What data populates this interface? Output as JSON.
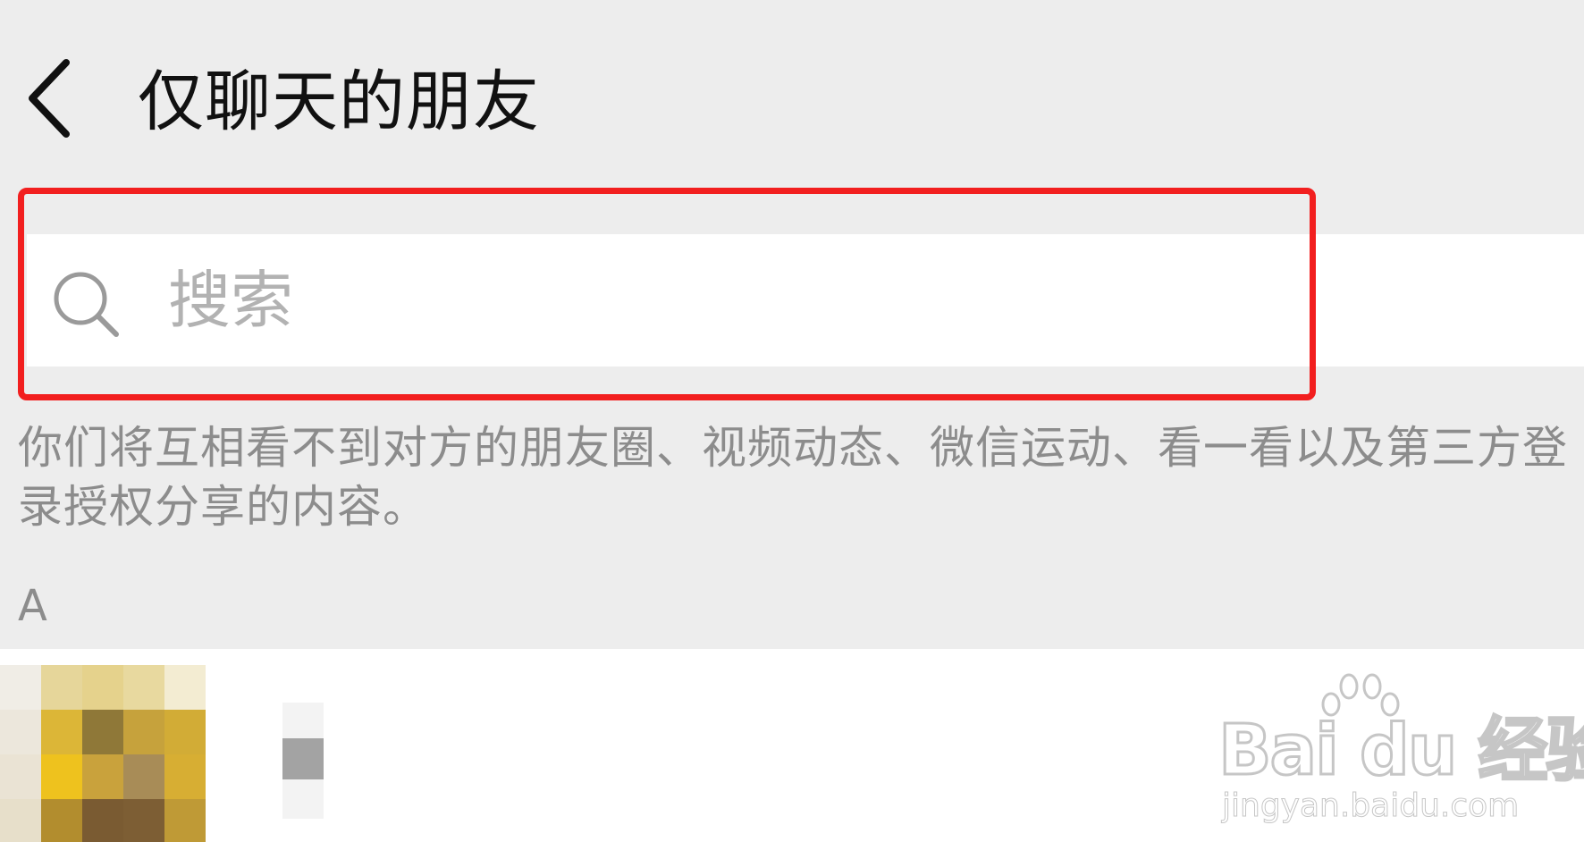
{
  "header": {
    "title": "仅聊天的朋友",
    "back_icon": "chevron-left-icon"
  },
  "search": {
    "placeholder": "搜索",
    "value": "",
    "icon": "search-icon"
  },
  "notice": {
    "text": "你们将互相看不到对方的朋友圈、视频动态、微信运动、看一看以及第三方登录授权分享的内容。"
  },
  "contacts": {
    "section_letter": "A"
  },
  "watermark": {
    "brand": "Bai du 经验",
    "url": "jingyan.baidu.com"
  },
  "colors": {
    "background": "#ededed",
    "highlight": "#f21f1f",
    "secondary_text": "#8c8c8c",
    "placeholder": "#b2b2b2"
  }
}
